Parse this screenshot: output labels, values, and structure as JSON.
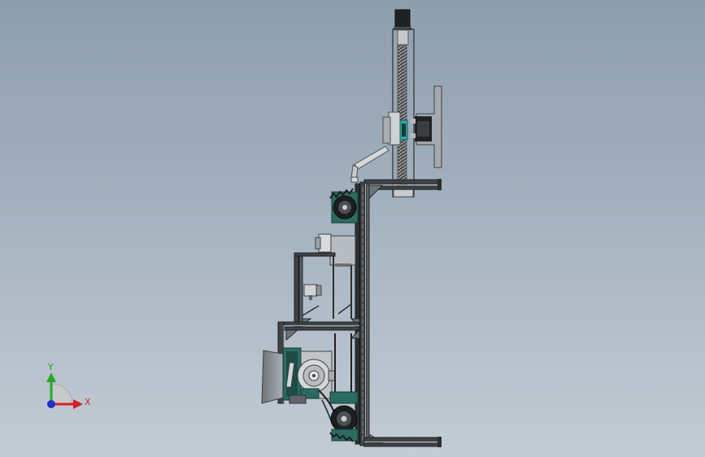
{
  "triad": {
    "x_label": "X",
    "y_label": "Y",
    "x_color": "#d4202a",
    "y_color": "#2aa52a",
    "z_color": "#2030c8"
  },
  "colors": {
    "frame": "#3d4246",
    "frame_dark": "#23272a",
    "frame_light": "#8d9599",
    "steel": "#b9bec2",
    "teal": "#2a6b62",
    "motor": "#1f2224",
    "lead_screw": "#5b5e60"
  }
}
